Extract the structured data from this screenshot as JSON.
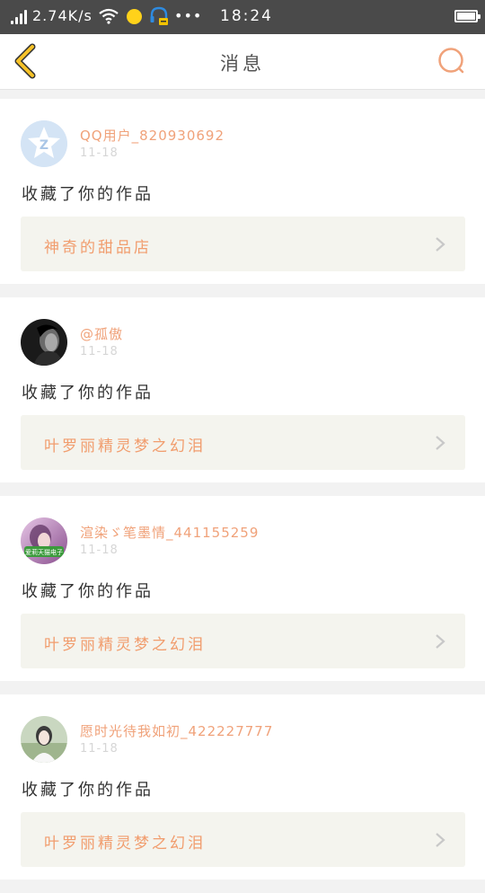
{
  "status_bar": {
    "net_speed": "2.74K/s",
    "more": "•••",
    "time": "18:24"
  },
  "nav": {
    "title": "消息"
  },
  "colors": {
    "accent": "#f0a27a",
    "back_icon": "#f7c228",
    "search_icon": "#f0a27a",
    "card_link_bg": "#f4f4ee"
  },
  "messages": [
    {
      "username": "QQ用户_820930692",
      "date": "11-18",
      "action": "收藏了你的作品",
      "work_title": "神奇的甜品店",
      "avatar": "qq-default-avatar"
    },
    {
      "username": "@孤傲",
      "date": "11-18",
      "action": "收藏了你的作品",
      "work_title": "叶罗丽精灵梦之幻泪",
      "avatar": "dark-portrait-avatar"
    },
    {
      "username": "渲染ゞ笔墨情_441155259",
      "date": "11-18",
      "action": "收藏了你的作品",
      "work_title": "叶罗丽精灵梦之幻泪",
      "avatar": "purple-photo-avatar",
      "avatar_badge": "爱莉天猫电子"
    },
    {
      "username": "愿时光待我如初_422227777",
      "date": "11-18",
      "action": "收藏了你的作品",
      "work_title": "叶罗丽精灵梦之幻泪",
      "avatar": "green-photo-avatar"
    }
  ]
}
